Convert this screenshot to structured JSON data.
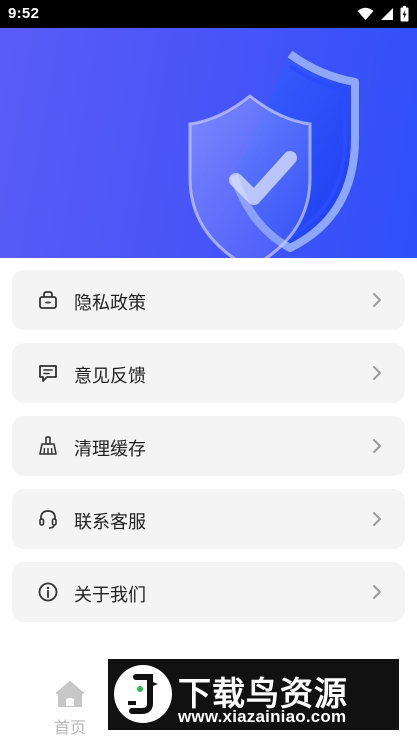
{
  "status_bar": {
    "time": "9:52",
    "icons": [
      "wifi-icon",
      "signal-icon",
      "battery-icon"
    ]
  },
  "hero": {
    "illustration": "shield-check-icon",
    "colors": {
      "gradient_start": "#5a5cf6",
      "gradient_end": "#2f4ff9"
    }
  },
  "menu": {
    "items": [
      {
        "label": "隐私政策",
        "icon": "privacy-icon"
      },
      {
        "label": "意见反馈",
        "icon": "feedback-icon"
      },
      {
        "label": "清理缓存",
        "icon": "broom-icon"
      },
      {
        "label": "联系客服",
        "icon": "headset-icon"
      },
      {
        "label": "关于我们",
        "icon": "info-icon"
      }
    ]
  },
  "bottom_nav": {
    "home_label": "首页",
    "home_icon": "home-icon"
  },
  "watermark": {
    "title": "下载鸟资源",
    "url": "www.xiazainiao.com"
  }
}
